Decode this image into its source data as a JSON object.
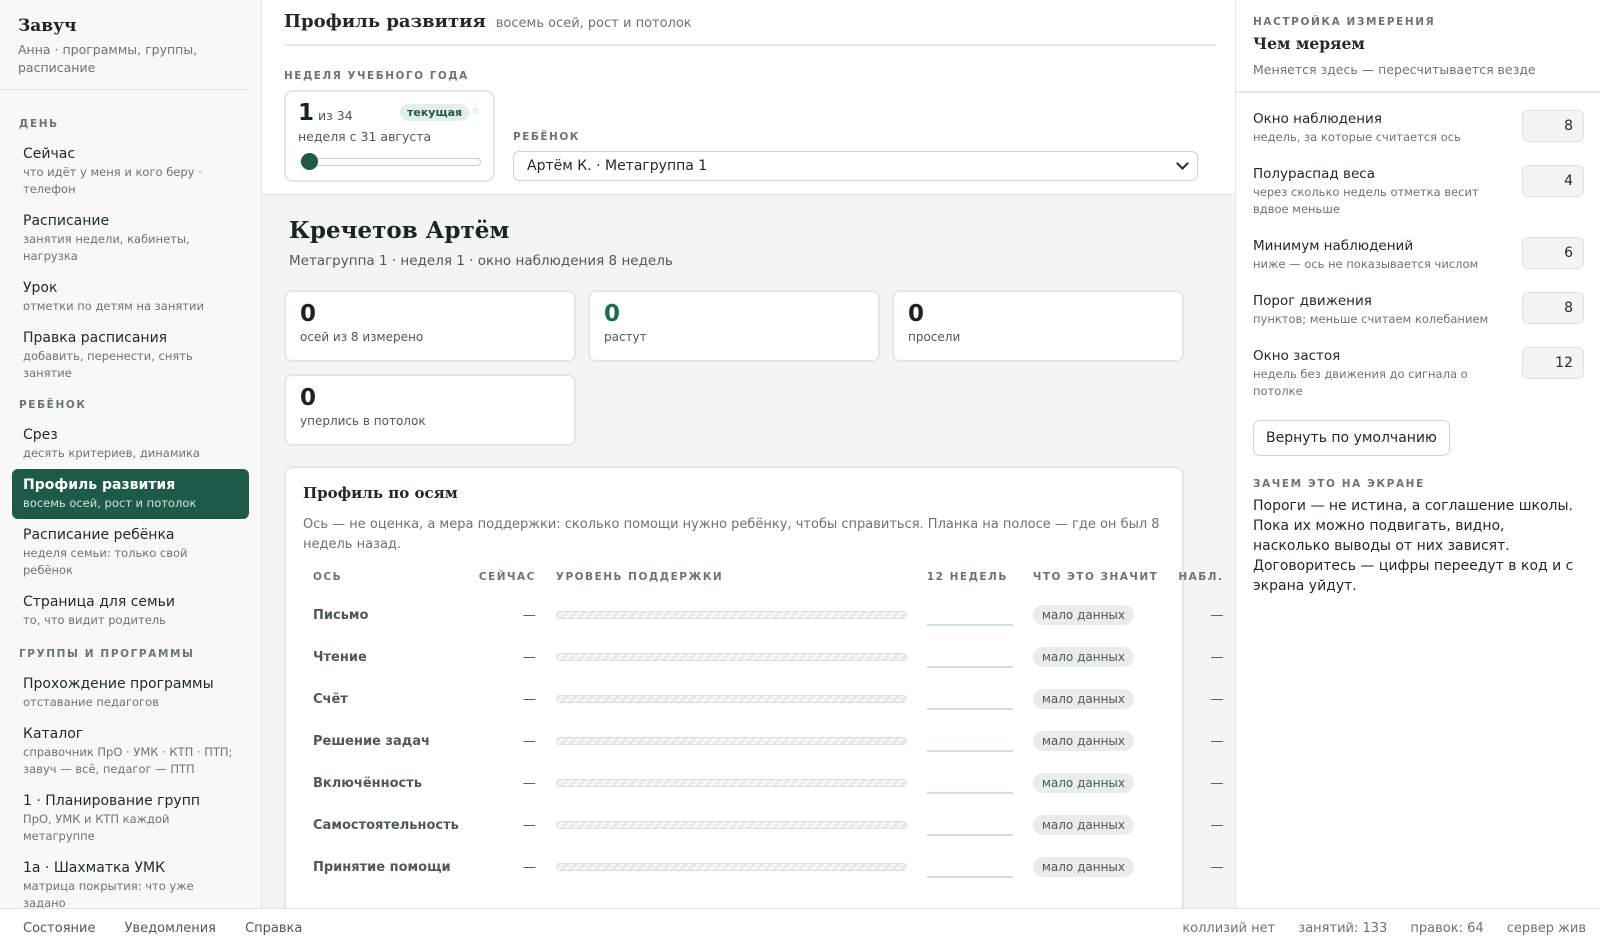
{
  "brand": {
    "title": "Завуч",
    "subtitle": "Анна · программы, группы, расписание"
  },
  "sidebar": {
    "sections": [
      {
        "label": "ДЕНЬ",
        "items": [
          {
            "title": "Сейчас",
            "sub": "что идёт у меня и кого беру · телефон"
          },
          {
            "title": "Расписание",
            "sub": "занятия недели, кабинеты, нагрузка"
          },
          {
            "title": "Урок",
            "sub": "отметки по детям на занятии"
          },
          {
            "title": "Правка расписания",
            "sub": "добавить, перенести, снять занятие"
          }
        ]
      },
      {
        "label": "РЕБЁНОК",
        "items": [
          {
            "title": "Срез",
            "sub": "десять критериев, динамика"
          },
          {
            "title": "Профиль развития",
            "sub": "восемь осей, рост и потолок",
            "active": true
          },
          {
            "title": "Расписание ребёнка",
            "sub": "неделя семьи: только свой ребёнок"
          },
          {
            "title": "Страница для семьи",
            "sub": "то, что видит родитель"
          }
        ]
      },
      {
        "label": "ГРУППЫ И ПРОГРАММЫ",
        "items": [
          {
            "title": "Прохождение программы",
            "sub": "отставание педагогов"
          },
          {
            "title": "Каталог",
            "sub": "справочник ПрО · УМК · КТП · ПТП; завуч — всё, педагог — ПТП"
          },
          {
            "title": "1 · Планирование групп",
            "sub": "ПрО, УМК и КТП каждой метагруппе"
          },
          {
            "title": "1а · Шахматка УМК",
            "sub": "матрица покрытия: что уже задано"
          }
        ]
      }
    ]
  },
  "header": {
    "title": "Профиль развития",
    "subtitle": "восемь осей, рост и потолок"
  },
  "week": {
    "label": "НЕДЕЛЯ УЧЕБНОГО ГОДА",
    "number": "1",
    "of": "из 34",
    "badge": "текущая",
    "start": "неделя с 31 августа",
    "current": 1,
    "total": 34
  },
  "child_select": {
    "label": "РЕБЁНОК",
    "value": "Артём К. · Метагруппа 1"
  },
  "child": {
    "name": "Кречетов Артём",
    "meta": "Метагруппа 1 · неделя 1 · окно наблюдения 8 недель"
  },
  "stats": [
    {
      "value": "0",
      "label": "осей из 8 измерено",
      "accent": false
    },
    {
      "value": "0",
      "label": "растут",
      "accent": true
    },
    {
      "value": "0",
      "label": "просели",
      "accent": false
    },
    {
      "value": "0",
      "label": "уперлись в потолок",
      "accent": false
    }
  ],
  "profile": {
    "title": "Профиль по осям",
    "desc": "Ось — не оценка, а мера поддержки: сколько помощи нужно ребёнку, чтобы справиться. Планка на полосе — где он был 8 недель назад.",
    "columns": [
      "ОСЬ",
      "СЕЙЧАС",
      "УРОВЕНЬ ПОДДЕРЖКИ",
      "12 НЕДЕЛЬ",
      "ЧТО ЭТО ЗНАЧИТ",
      "НАБЛ."
    ],
    "rows": [
      {
        "axis": "Письмо",
        "now": "—",
        "meaning": "мало данных",
        "obs": "—"
      },
      {
        "axis": "Чтение",
        "now": "—",
        "meaning": "мало данных",
        "obs": "—"
      },
      {
        "axis": "Счёт",
        "now": "—",
        "meaning": "мало данных",
        "obs": "—"
      },
      {
        "axis": "Решение задач",
        "now": "—",
        "meaning": "мало данных",
        "obs": "—"
      },
      {
        "axis": "Включённость",
        "now": "—",
        "meaning": "мало данных",
        "obs": "—"
      },
      {
        "axis": "Самостоятельность",
        "now": "—",
        "meaning": "мало данных",
        "obs": "—"
      },
      {
        "axis": "Принятие помощи",
        "now": "—",
        "meaning": "мало данных",
        "obs": "—"
      }
    ]
  },
  "settings": {
    "eyebrow": "НАСТРОЙКА ИЗМЕРЕНИЯ",
    "title": "Чем меряем",
    "subtitle": "Меняется здесь — пересчитывается везде",
    "items": [
      {
        "name": "Окно наблюдения",
        "hint": "недель, за которые считается ось",
        "value": "8"
      },
      {
        "name": "Полураспад веса",
        "hint": "через сколько недель отметка весит вдвое меньше",
        "value": "4"
      },
      {
        "name": "Минимум наблюдений",
        "hint": "ниже — ось не показывается числом",
        "value": "6"
      },
      {
        "name": "Порог движения",
        "hint": "пунктов; меньше считаем колебанием",
        "value": "8"
      },
      {
        "name": "Окно застоя",
        "hint": "недель без движения до сигнала о потолке",
        "value": "12"
      }
    ],
    "reset_label": "Вернуть по умолчанию",
    "why_label": "ЗАЧЕМ ЭТО НА ЭКРАНЕ",
    "why_text": "Пороги — не истина, а соглашение школы. Пока их можно подвигать, видно, насколько выводы от них зависят. Договоритесь — цифры переедут в код и с экрана уйдут."
  },
  "footer": {
    "links": [
      "Состояние",
      "Уведомления",
      "Справка"
    ],
    "status": [
      "коллизий нет",
      "занятий: 133",
      "правок: 64",
      "сервер жив"
    ]
  },
  "colors": {
    "accent": "#1d5a48",
    "accent_text": "#1d6b52",
    "badge_bg": "#e3efe9"
  }
}
